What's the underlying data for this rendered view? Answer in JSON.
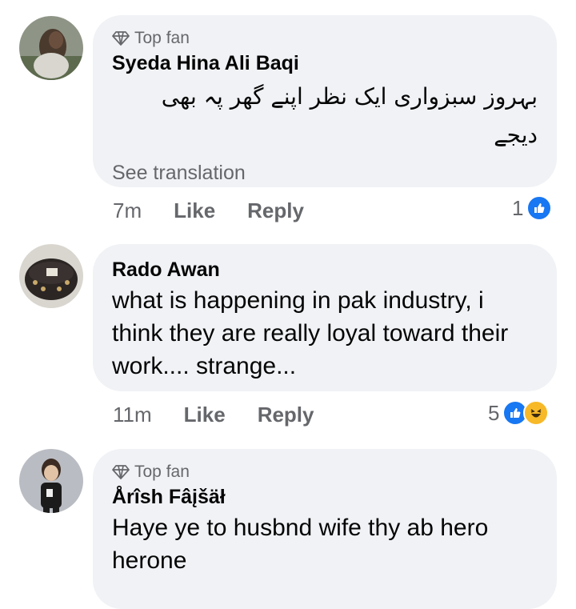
{
  "comments": [
    {
      "badge": "Top fan",
      "name": "Syeda Hina Ali Baqi",
      "text": "بہروز سبزواری  ایک نظر اپنے گھر پہ بھی دیجے",
      "see_translation": "See translation",
      "time": "7m",
      "like": "Like",
      "reply": "Reply",
      "reaction_count": "1",
      "reactions": [
        "like-icon"
      ]
    },
    {
      "name": "Rado Awan",
      "text": "what is happening in pak industry, i think they are really loyal toward their work.... strange...",
      "time": "11m",
      "like": "Like",
      "reply": "Reply",
      "reaction_count": "5",
      "reactions": [
        "like-icon",
        "haha-icon"
      ]
    },
    {
      "badge": "Top fan",
      "name": "Årîsh Fâįšäł",
      "text": "Haye ye to husbnd wife thy ab hero herone"
    }
  ],
  "colors": {
    "bubble": "#f0f2f5",
    "secondary_text": "#65676b",
    "like_blue": "#1877f2",
    "haha_yellow": "#f7b928"
  }
}
